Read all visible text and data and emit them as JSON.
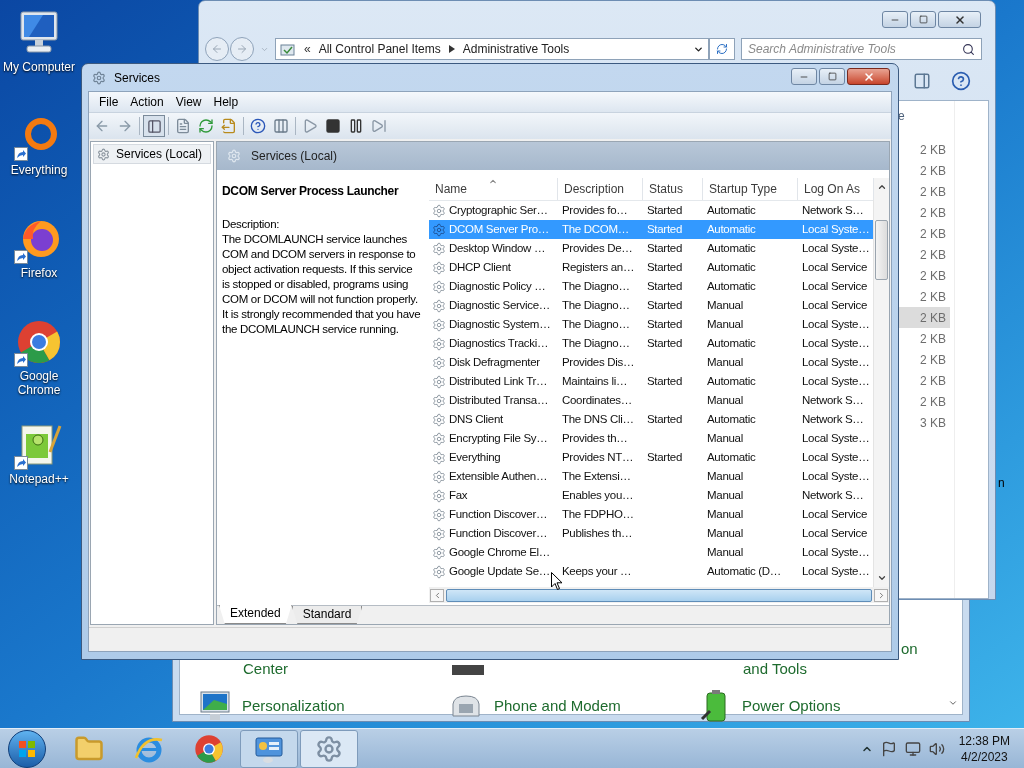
{
  "desktop": {
    "icons": [
      {
        "label": "My Computer",
        "kind": "computer",
        "shortcut": false
      },
      {
        "label": "Everything",
        "kind": "everything",
        "shortcut": true
      },
      {
        "label": "Firefox",
        "kind": "firefox",
        "shortcut": true
      },
      {
        "label": "Google Chrome",
        "kind": "chrome",
        "shortcut": true
      },
      {
        "label": "Notepad++",
        "kind": "notepad",
        "shortcut": true
      }
    ],
    "fragment": "n"
  },
  "control_panel_window": {
    "fragments": [
      "Center",
      "and Tools",
      "on"
    ],
    "items": [
      {
        "label": "Personalization",
        "kind": "personalization"
      },
      {
        "label": "Phone and Modem",
        "kind": "phone"
      },
      {
        "label": "Power Options",
        "kind": "power"
      }
    ]
  },
  "admin_tools_window": {
    "address_overflow": "«",
    "address": [
      "All Control Panel Items",
      "Administrative Tools"
    ],
    "search": {
      "placeholder": "Search Administrative Tools"
    },
    "column_fragment": "e",
    "sizes": [
      {
        "text": "2 KB",
        "selected": false
      },
      {
        "text": "2 KB",
        "selected": false
      },
      {
        "text": "2 KB",
        "selected": false
      },
      {
        "text": "2 KB",
        "selected": false
      },
      {
        "text": "2 KB",
        "selected": false
      },
      {
        "text": "2 KB",
        "selected": false
      },
      {
        "text": "2 KB",
        "selected": false
      },
      {
        "text": "2 KB",
        "selected": false
      },
      {
        "text": "2 KB",
        "selected": true
      },
      {
        "text": "2 KB",
        "selected": false
      },
      {
        "text": "2 KB",
        "selected": false
      },
      {
        "text": "2 KB",
        "selected": false
      },
      {
        "text": "2 KB",
        "selected": false
      },
      {
        "text": "3 KB",
        "selected": false
      }
    ]
  },
  "services_window": {
    "title": "Services",
    "menu": [
      "File",
      "Action",
      "View",
      "Help"
    ],
    "tree": [
      {
        "label": "Services (Local)",
        "selected": true
      }
    ],
    "pane_title": "Services (Local)",
    "detail": {
      "name": "DCOM Server Process Launcher",
      "description_label": "Description:",
      "description": "The DCOMLAUNCH service launches COM and DCOM servers in response to object activation requests. If this service is stopped or disabled, programs using COM or DCOM will not function properly. It is strongly recommended that you have the DCOMLAUNCH service running."
    },
    "columns": [
      {
        "label": "Name",
        "sorted": true
      },
      {
        "label": "Description",
        "sorted": false
      },
      {
        "label": "Status",
        "sorted": false
      },
      {
        "label": "Startup Type",
        "sorted": false
      },
      {
        "label": "Log On As",
        "sorted": false
      }
    ],
    "rows": [
      {
        "name": "Cryptographic Ser…",
        "description": "Provides fo…",
        "status": "Started",
        "startup_type": "Automatic",
        "log_on_as": "Network S…",
        "selected": false
      },
      {
        "name": "DCOM Server Pro…",
        "description": "The DCOM…",
        "status": "Started",
        "startup_type": "Automatic",
        "log_on_as": "Local Syste…",
        "selected": true
      },
      {
        "name": "Desktop Window …",
        "description": "Provides De…",
        "status": "Started",
        "startup_type": "Automatic",
        "log_on_as": "Local Syste…",
        "selected": false
      },
      {
        "name": "DHCP Client",
        "description": "Registers an…",
        "status": "Started",
        "startup_type": "Automatic",
        "log_on_as": "Local Service",
        "selected": false
      },
      {
        "name": "Diagnostic Policy …",
        "description": "The Diagno…",
        "status": "Started",
        "startup_type": "Automatic",
        "log_on_as": "Local Service",
        "selected": false
      },
      {
        "name": "Diagnostic Service…",
        "description": "The Diagno…",
        "status": "Started",
        "startup_type": "Manual",
        "log_on_as": "Local Service",
        "selected": false
      },
      {
        "name": "Diagnostic System…",
        "description": "The Diagno…",
        "status": "Started",
        "startup_type": "Manual",
        "log_on_as": "Local Syste…",
        "selected": false
      },
      {
        "name": "Diagnostics Tracki…",
        "description": "The Diagno…",
        "status": "Started",
        "startup_type": "Automatic",
        "log_on_as": "Local Syste…",
        "selected": false
      },
      {
        "name": "Disk Defragmenter",
        "description": "Provides Dis…",
        "startup_type": "Manual",
        "log_on_as": "Local Syste…",
        "selected": false
      },
      {
        "name": "Distributed Link Tr…",
        "description": "Maintains li…",
        "status": "Started",
        "startup_type": "Automatic",
        "log_on_as": "Local Syste…",
        "selected": false
      },
      {
        "name": "Distributed Transa…",
        "description": "Coordinates…",
        "startup_type": "Manual",
        "log_on_as": "Network S…",
        "selected": false
      },
      {
        "name": "DNS Client",
        "description": "The DNS Cli…",
        "status": "Started",
        "startup_type": "Automatic",
        "log_on_as": "Network S…",
        "selected": false
      },
      {
        "name": "Encrypting File Sy…",
        "description": "Provides th…",
        "startup_type": "Manual",
        "log_on_as": "Local Syste…",
        "selected": false
      },
      {
        "name": "Everything",
        "description": "Provides NT…",
        "status": "Started",
        "startup_type": "Automatic",
        "log_on_as": "Local Syste…",
        "selected": false
      },
      {
        "name": "Extensible Authen…",
        "description": "The Extensi…",
        "startup_type": "Manual",
        "log_on_as": "Local Syste…",
        "selected": false
      },
      {
        "name": "Fax",
        "description": "Enables you…",
        "startup_type": "Manual",
        "log_on_as": "Network S…",
        "selected": false
      },
      {
        "name": "Function Discover…",
        "description": "The FDPHO…",
        "startup_type": "Manual",
        "log_on_as": "Local Service",
        "selected": false
      },
      {
        "name": "Function Discover…",
        "description": "Publishes th…",
        "startup_type": "Manual",
        "log_on_as": "Local Service",
        "selected": false
      },
      {
        "name": "Google Chrome El…",
        "startup_type": "Manual",
        "log_on_as": "Local Syste…",
        "selected": false
      },
      {
        "name": "Google Update Se…",
        "description": "Keeps your …",
        "startup_type": "Automatic (D…",
        "log_on_as": "Local Syste…",
        "selected": false
      }
    ],
    "tabs": [
      {
        "label": "Extended",
        "selected": true
      },
      {
        "label": "Standard",
        "selected": false
      }
    ]
  },
  "taskbar": {
    "buttons": [
      {
        "kind": "folder",
        "running": false,
        "selected": false
      },
      {
        "kind": "ie",
        "running": false,
        "selected": false
      },
      {
        "kind": "chrome",
        "running": false,
        "selected": false
      },
      {
        "kind": "control_panel",
        "running": true,
        "selected": false
      },
      {
        "kind": "services",
        "running": true,
        "selected": true
      }
    ],
    "time": "12:38 PM",
    "date": "4/2/2023"
  }
}
